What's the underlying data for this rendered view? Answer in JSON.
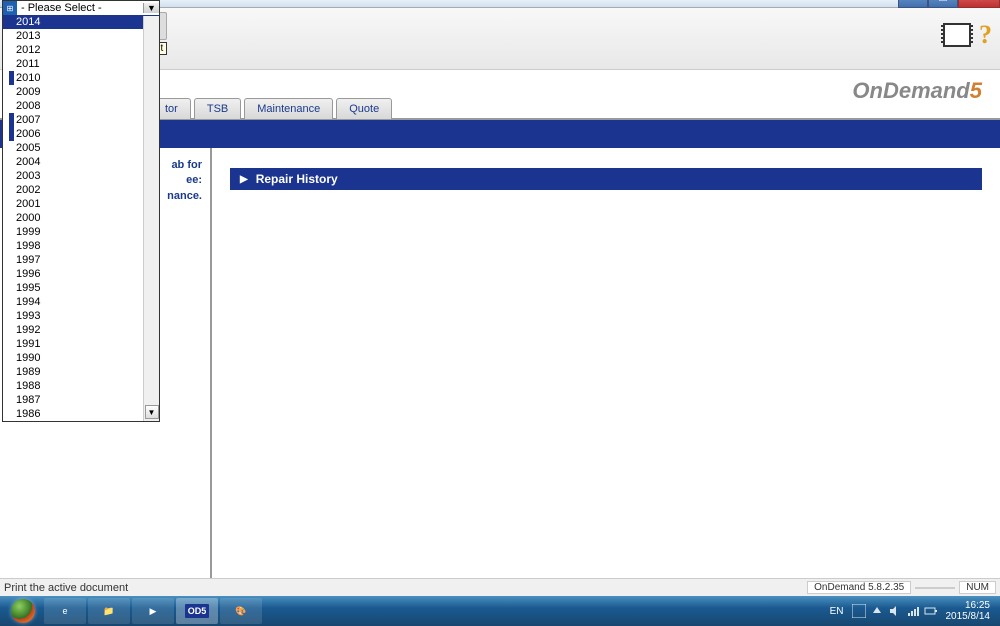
{
  "window": {
    "controls": {
      "min": "—",
      "max": "☐",
      "close": "✕"
    }
  },
  "toolbar": {
    "print_label": "Print"
  },
  "logo": {
    "text": "OnDemand",
    "num": "5"
  },
  "tabs": [
    {
      "label": "tor"
    },
    {
      "label": "TSB"
    },
    {
      "label": "Maintenance"
    },
    {
      "label": "Quote"
    }
  ],
  "sidebar": {
    "line1": "ab for",
    "line2": "ee:",
    "line3": "nance."
  },
  "main": {
    "section_title": "Repair History"
  },
  "statusbar": {
    "message": "Print the active document",
    "app_version": "OnDemand 5.8.2.35",
    "num": "NUM"
  },
  "dropdown": {
    "placeholder": "- Please Select -",
    "items": [
      {
        "year": "2014",
        "selected": true
      },
      {
        "year": "2013"
      },
      {
        "year": "2012"
      },
      {
        "year": "2011"
      },
      {
        "year": "2010",
        "marked": true
      },
      {
        "year": "2009"
      },
      {
        "year": "2008"
      },
      {
        "year": "2007",
        "marked": true
      },
      {
        "year": "2006",
        "marked": true
      },
      {
        "year": "2005"
      },
      {
        "year": "2004"
      },
      {
        "year": "2003"
      },
      {
        "year": "2002"
      },
      {
        "year": "2001"
      },
      {
        "year": "2000"
      },
      {
        "year": "1999"
      },
      {
        "year": "1998"
      },
      {
        "year": "1997"
      },
      {
        "year": "1996"
      },
      {
        "year": "1995"
      },
      {
        "year": "1994"
      },
      {
        "year": "1993"
      },
      {
        "year": "1992"
      },
      {
        "year": "1991"
      },
      {
        "year": "1990"
      },
      {
        "year": "1989"
      },
      {
        "year": "1988"
      },
      {
        "year": "1987"
      },
      {
        "year": "1986"
      }
    ]
  },
  "taskbar": {
    "items": [
      {
        "name": "ie",
        "glyph": "e"
      },
      {
        "name": "explorer",
        "glyph": "📁"
      },
      {
        "name": "media",
        "glyph": "▶"
      },
      {
        "name": "od5",
        "glyph": "OD5",
        "active": true
      },
      {
        "name": "paint",
        "glyph": "🎨"
      }
    ],
    "lang": "EN",
    "time": "16:25",
    "date": "2015/8/14"
  }
}
